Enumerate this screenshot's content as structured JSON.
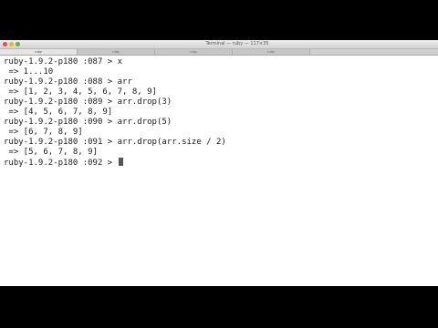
{
  "window": {
    "title": "Terminal — ruby — 117×35"
  },
  "tabs": [
    {
      "label": "ruby"
    },
    {
      "label": "ruby"
    },
    {
      "label": "ruby"
    },
    {
      "label": "ruby"
    }
  ],
  "terminal": {
    "lines": [
      {
        "prompt": "ruby-1.9.2-p180 :087 > ",
        "text": "x"
      },
      {
        "prompt": "",
        "text": " => 1...10"
      },
      {
        "prompt": "ruby-1.9.2-p180 :088 > ",
        "text": "arr"
      },
      {
        "prompt": "",
        "text": " => [1, 2, 3, 4, 5, 6, 7, 8, 9]"
      },
      {
        "prompt": "ruby-1.9.2-p180 :089 > ",
        "text": "arr.drop(3)"
      },
      {
        "prompt": "",
        "text": " => [4, 5, 6, 7, 8, 9]"
      },
      {
        "prompt": "ruby-1.9.2-p180 :090 > ",
        "text": "arr.drop(5)"
      },
      {
        "prompt": "",
        "text": " => [6, 7, 8, 9]"
      },
      {
        "prompt": "ruby-1.9.2-p180 :091 > ",
        "text": "arr.drop(arr.size / 2)"
      },
      {
        "prompt": "",
        "text": " => [5, 6, 7, 8, 9]"
      },
      {
        "prompt": "ruby-1.9.2-p180 :092 > ",
        "text": ""
      }
    ]
  }
}
